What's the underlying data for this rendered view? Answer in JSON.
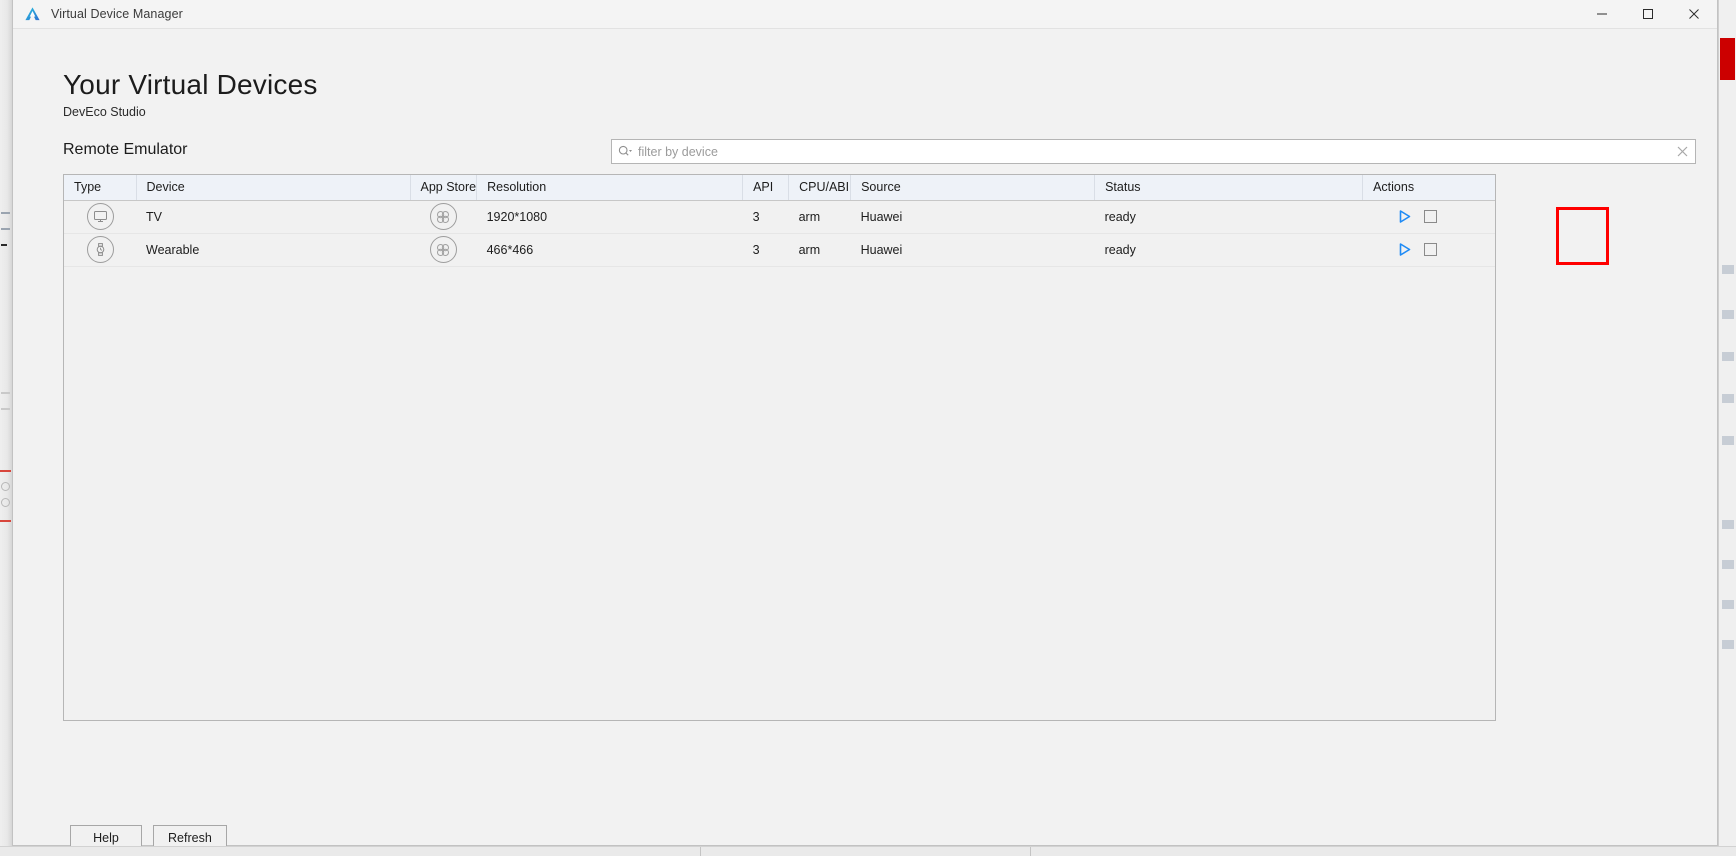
{
  "window": {
    "title": "Virtual Device Manager",
    "app_icon": "deveco-logo-icon",
    "controls": {
      "minimize": "minimize-icon",
      "maximize": "maximize-icon",
      "close": "close-icon"
    }
  },
  "page": {
    "title": "Your Virtual Devices",
    "subtitle": "DevEco Studio",
    "section_title": "Remote Emulator"
  },
  "search": {
    "placeholder": "filter by device",
    "value": "",
    "icon": "search-icon",
    "clear_icon": "clear-icon"
  },
  "table": {
    "columns": [
      "Type",
      "Device",
      "App Store",
      "Resolution",
      "API",
      "CPU/ABI",
      "Source",
      "Status",
      "Actions"
    ],
    "rows": [
      {
        "type_icon": "tv-monitor-icon",
        "device": "TV",
        "appstore_icon": "appgallery-flower-icon",
        "resolution": "1920*1080",
        "api": "3",
        "cpu_abi": "arm",
        "source": "Huawei",
        "status": "ready",
        "actions": {
          "play": "play-icon",
          "stop": "stop-icon"
        }
      },
      {
        "type_icon": "wearable-watch-icon",
        "device": "Wearable",
        "appstore_icon": "appgallery-flower-icon",
        "resolution": "466*466",
        "api": "3",
        "cpu_abi": "arm",
        "source": "Huawei",
        "status": "ready",
        "actions": {
          "play": "play-icon",
          "stop": "stop-icon"
        }
      }
    ]
  },
  "footer": {
    "help_label": "Help",
    "refresh_label": "Refresh"
  },
  "colors": {
    "accent_blue": "#1f8bf5",
    "annotation_red": "#ff0000",
    "header_bg": "#eef2f8",
    "panel_bg": "#f1f1f1",
    "window_bg": "#f2f2f2"
  }
}
